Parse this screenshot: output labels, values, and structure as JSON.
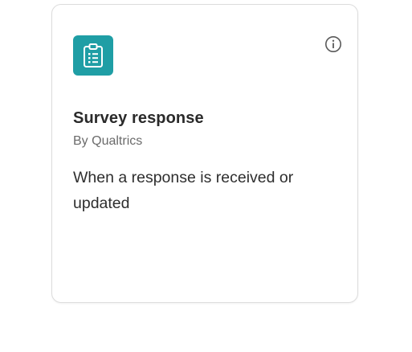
{
  "card": {
    "title": "Survey response",
    "provider": "By Qualtrics",
    "description": "When a response is received or updated",
    "app_icon": "clipboard-list-icon",
    "app_icon_color": "#1f9ea5",
    "info_icon": "info-icon"
  }
}
